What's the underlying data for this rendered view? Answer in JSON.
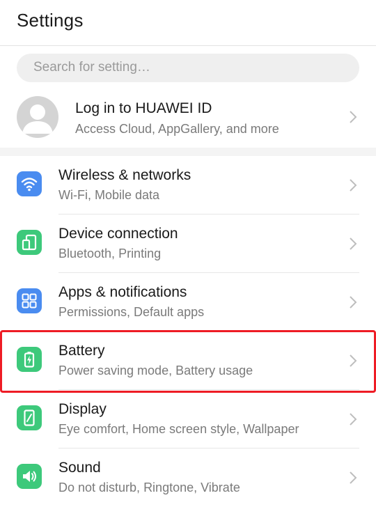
{
  "header": {
    "title": "Settings"
  },
  "search": {
    "placeholder": "Search for setting…"
  },
  "account": {
    "title": "Log in to HUAWEI ID",
    "subtitle": "Access Cloud, AppGallery, and more"
  },
  "settings": [
    {
      "title": "Wireless & networks",
      "subtitle": "Wi-Fi, Mobile data",
      "icon": "wifi-icon",
      "color": "#4a8cf0"
    },
    {
      "title": "Device connection",
      "subtitle": "Bluetooth, Printing",
      "icon": "device-connection-icon",
      "color": "#3dc97b"
    },
    {
      "title": "Apps & notifications",
      "subtitle": "Permissions, Default apps",
      "icon": "apps-grid-icon",
      "color": "#4a8cf0"
    },
    {
      "title": "Battery",
      "subtitle": "Power saving mode, Battery usage",
      "icon": "battery-icon",
      "color": "#3dc97b"
    },
    {
      "title": "Display",
      "subtitle": "Eye comfort, Home screen style, Wallpaper",
      "icon": "display-icon",
      "color": "#3dc97b"
    },
    {
      "title": "Sound",
      "subtitle": "Do not disturb, Ringtone, Vibrate",
      "icon": "speaker-icon",
      "color": "#3dc97b"
    }
  ],
  "highlight_color": "#ee1c25"
}
